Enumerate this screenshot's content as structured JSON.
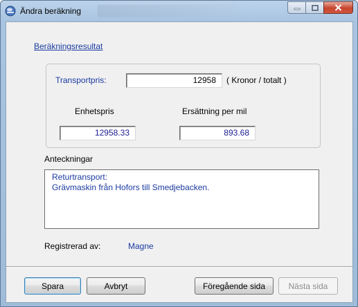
{
  "window": {
    "title": "Ändra beräkning"
  },
  "section": {
    "results_link": "Beräkningsresultat"
  },
  "results": {
    "transport_label": "Transportpris:",
    "transport_value": "12958",
    "transport_unit": "( Kronor / totalt )",
    "unit_price_label": "Enhetspris",
    "unit_price_value": "12958.33",
    "per_mile_label": "Ersättning per mil",
    "per_mile_value": "893.68"
  },
  "notes": {
    "label": "Anteckningar",
    "lines": [
      "Returtransport:",
      "Grävmaskin från Hofors till Smedjebacken."
    ]
  },
  "registered": {
    "label": "Registrerad av:",
    "value": "Magne"
  },
  "buttons": {
    "save": "Spara",
    "cancel": "Avbryt",
    "previous": "Föregående sida",
    "next": "Nästa sida"
  },
  "icons": {
    "app": "app-icon",
    "minimize": "minimize-icon",
    "maximize": "maximize-icon",
    "close": "close-icon"
  },
  "colors": {
    "link": "#1a3aa0",
    "close_button": "#c7452f"
  }
}
